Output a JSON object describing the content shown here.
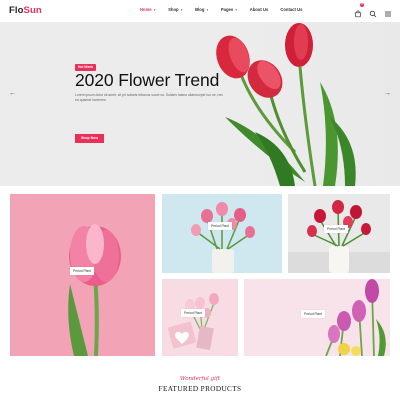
{
  "header": {
    "logo_part1": "Flo",
    "logo_part2": "Sun",
    "nav": [
      {
        "label": "Home",
        "caret": true
      },
      {
        "label": "Shop",
        "caret": true
      },
      {
        "label": "Blog",
        "caret": true
      },
      {
        "label": "Pages",
        "caret": true
      },
      {
        "label": "About Us",
        "caret": false
      },
      {
        "label": "Contact Us",
        "caret": false
      }
    ],
    "cart_count": "0",
    "icons": [
      "cart-icon",
      "search-icon",
      "menu-icon"
    ]
  },
  "hero": {
    "badge": "Hot Week",
    "title": "2020 Flower Trend",
    "text": "Lorem ipsum dolor sit amet, sit pri sollaris tebanus vocet os. Sullaris fasiea ullamcorper ius ne, nec ea quaerat invenires.",
    "button": "Shop Now",
    "prev_icon": "chevron-left-icon",
    "next_icon": "chevron-right-icon"
  },
  "gallery": [
    {
      "label": "Period Plant",
      "bg": "#f2a3b6"
    },
    {
      "label": "Period Plant",
      "bg": "#cfe7ee"
    },
    {
      "label": "Period Plant",
      "bg": "#e9e9e9"
    },
    {
      "label": "Period Plant",
      "bg": "#f7dde3"
    },
    {
      "label": "Period Plant",
      "bg": "#f9e3ea"
    }
  ],
  "featured": {
    "script": "Wonderful gift",
    "title": "FEATURED PRODUCTS"
  },
  "colors": {
    "accent": "#e8305a"
  }
}
